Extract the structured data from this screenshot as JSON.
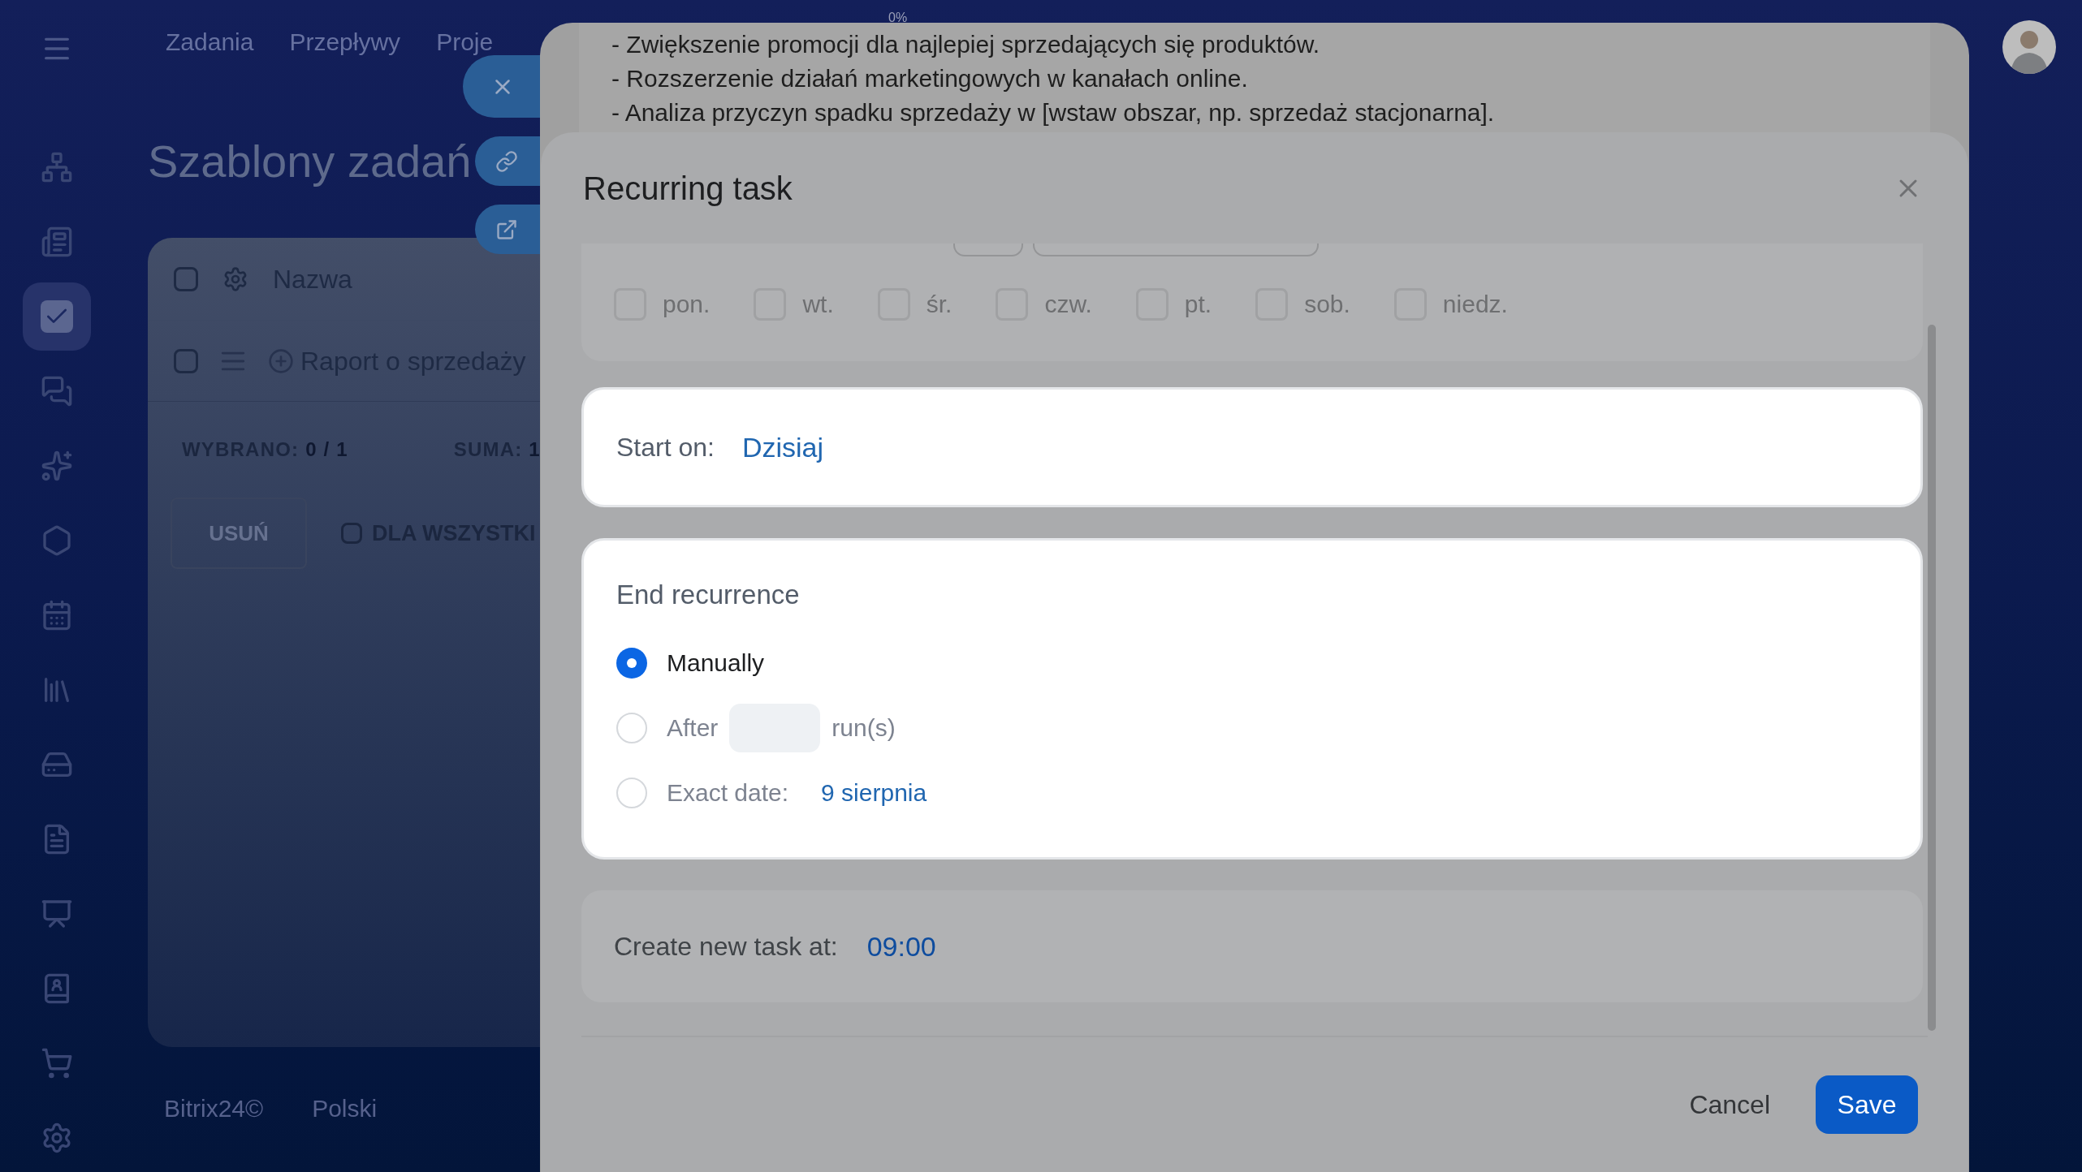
{
  "top_nav": {
    "items": [
      {
        "label": "Zadania"
      },
      {
        "label": "Przepływy"
      },
      {
        "label": "Proje"
      }
    ]
  },
  "sidebar": {
    "items": [
      {
        "selected": false
      },
      {
        "selected": false
      },
      {
        "selected": true
      },
      {
        "selected": false
      },
      {
        "selected": false
      },
      {
        "selected": false
      },
      {
        "selected": false
      },
      {
        "selected": false
      },
      {
        "selected": false
      },
      {
        "selected": false
      },
      {
        "selected": false
      },
      {
        "selected": false
      },
      {
        "selected": false
      },
      {
        "selected": false
      }
    ]
  },
  "page": {
    "title": "Szablony zadań",
    "table": {
      "header_checked": false,
      "columns": [
        "Nazwa"
      ],
      "rows": [
        {
          "name": "Raport o sprzedaży",
          "checked": false
        }
      ],
      "summary": {
        "selected_label": "WYBRANO:",
        "selected_value": "0 / 1",
        "total_label": "SUMA:",
        "total_value": "1"
      },
      "delete_button": "USUŃ",
      "for_all": {
        "label": "DLA WSZYSTKI",
        "checked": false
      }
    }
  },
  "footer": {
    "brand": "Bitrix24©",
    "language": "Polski"
  },
  "task_panel": {
    "progress": "0%",
    "description_lines": [
      "- Zwiększenie promocji dla najlepiej sprzedających się produktów.",
      "- Rozszerzenie działań marketingowych w kanałach online.",
      "- Analiza przyczyn spadku sprzedaży w [wstaw obszar, np. sprzedaż stacjonarna]."
    ]
  },
  "dialog": {
    "title": "Recurring task",
    "weekdays": [
      {
        "label": "pon.",
        "checked": false
      },
      {
        "label": "wt.",
        "checked": false
      },
      {
        "label": "śr.",
        "checked": false
      },
      {
        "label": "czw.",
        "checked": false
      },
      {
        "label": "pt.",
        "checked": false
      },
      {
        "label": "sob.",
        "checked": false
      },
      {
        "label": "niedz.",
        "checked": false
      }
    ],
    "start": {
      "label": "Start on:",
      "value": "Dzisiaj"
    },
    "end": {
      "title": "End recurrence",
      "options": [
        {
          "kind": "manual",
          "label": "Manually",
          "selected": true
        },
        {
          "kind": "after",
          "label": "After",
          "suffix": "run(s)",
          "selected": false
        },
        {
          "kind": "date",
          "label": "Exact date:",
          "value": "9 sierpnia",
          "selected": false
        }
      ]
    },
    "time": {
      "label": "Create new task at:",
      "value": "09:00"
    },
    "buttons": {
      "cancel": "Cancel",
      "save": "Save"
    }
  }
}
